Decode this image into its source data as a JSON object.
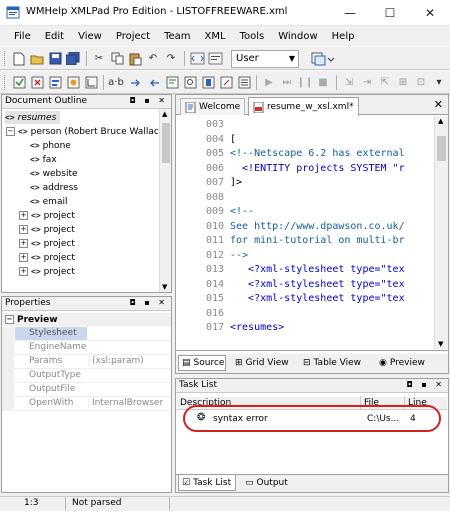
{
  "window": {
    "title": "WMHelp XMLPad Pro Edition - LISTOFFREEWARE.xml",
    "minimize_glyph": "—",
    "maximize_glyph": "☐",
    "close_glyph": "✕"
  },
  "menu": [
    "File",
    "Edit",
    "View",
    "Project",
    "Team",
    "XML",
    "Tools",
    "Window",
    "Help"
  ],
  "toolbar": {
    "user_combo": "User"
  },
  "outline": {
    "title": "Document Outline",
    "items": [
      {
        "label": "resumes",
        "icon": "element-icon"
      },
      {
        "label": "person (Robert Bruce Wallace",
        "icon": "element-icon"
      },
      {
        "label": "phone",
        "icon": "element-icon"
      },
      {
        "label": "fax",
        "icon": "element-icon"
      },
      {
        "label": "website",
        "icon": "element-icon"
      },
      {
        "label": "address",
        "icon": "element-icon"
      },
      {
        "label": "email",
        "icon": "element-icon"
      },
      {
        "label": "project",
        "icon": "element-icon"
      },
      {
        "label": "project",
        "icon": "element-icon"
      },
      {
        "label": "project",
        "icon": "element-icon"
      },
      {
        "label": "project",
        "icon": "element-icon"
      },
      {
        "label": "project",
        "icon": "element-icon"
      }
    ]
  },
  "properties": {
    "title": "Properties",
    "section": "Preview",
    "rows": [
      {
        "name": "Stylesheet",
        "value": ""
      },
      {
        "name": "EngineName",
        "value": ""
      },
      {
        "name": "Params",
        "value": "(xsl:param)"
      },
      {
        "name": "OutputType",
        "value": ""
      },
      {
        "name": "OutputFile",
        "value": ""
      },
      {
        "name": "OpenWith",
        "value": "InternalBrowser"
      }
    ]
  },
  "editor": {
    "tabs": [
      "Welcome",
      "resume_w_xsl.xml*"
    ],
    "lines": [
      {
        "n": "003",
        "t": ""
      },
      {
        "n": "004",
        "t": "["
      },
      {
        "n": "005",
        "t": "<!--Netscape 6.2 has external"
      },
      {
        "n": "006",
        "t": "  <!ENTITY projects SYSTEM \"r"
      },
      {
        "n": "007",
        "t": "]>"
      },
      {
        "n": "008",
        "t": ""
      },
      {
        "n": "009",
        "t": "<!--"
      },
      {
        "n": "010",
        "t": "See http://www.dpawson.co.uk/"
      },
      {
        "n": "011",
        "t": "for mini-tutorial on multi-br"
      },
      {
        "n": "012",
        "t": "-->"
      },
      {
        "n": "013",
        "t": "   <?xml-stylesheet type=\"tex"
      },
      {
        "n": "014",
        "t": "   <?xml-stylesheet type=\"tex"
      },
      {
        "n": "015",
        "t": "   <?xml-stylesheet type=\"tex"
      },
      {
        "n": "016",
        "t": ""
      },
      {
        "n": "017",
        "t": "<resumes>"
      }
    ],
    "view_tabs": [
      "Source",
      "Grid View",
      "Table View",
      "Preview"
    ]
  },
  "tasks": {
    "title": "Task List",
    "columns": [
      "Description",
      "File",
      "Line"
    ],
    "rows": [
      {
        "description": "syntax error",
        "file": "C:\\Us...",
        "line": "4"
      }
    ],
    "bottom_tabs": [
      "Task List",
      "Output"
    ]
  },
  "status": {
    "position": "1:3",
    "parse_state": "Not parsed"
  },
  "colors": {
    "highlight_oval": "#d42020",
    "tag": "#0000c8",
    "comment": "#1060a0"
  }
}
